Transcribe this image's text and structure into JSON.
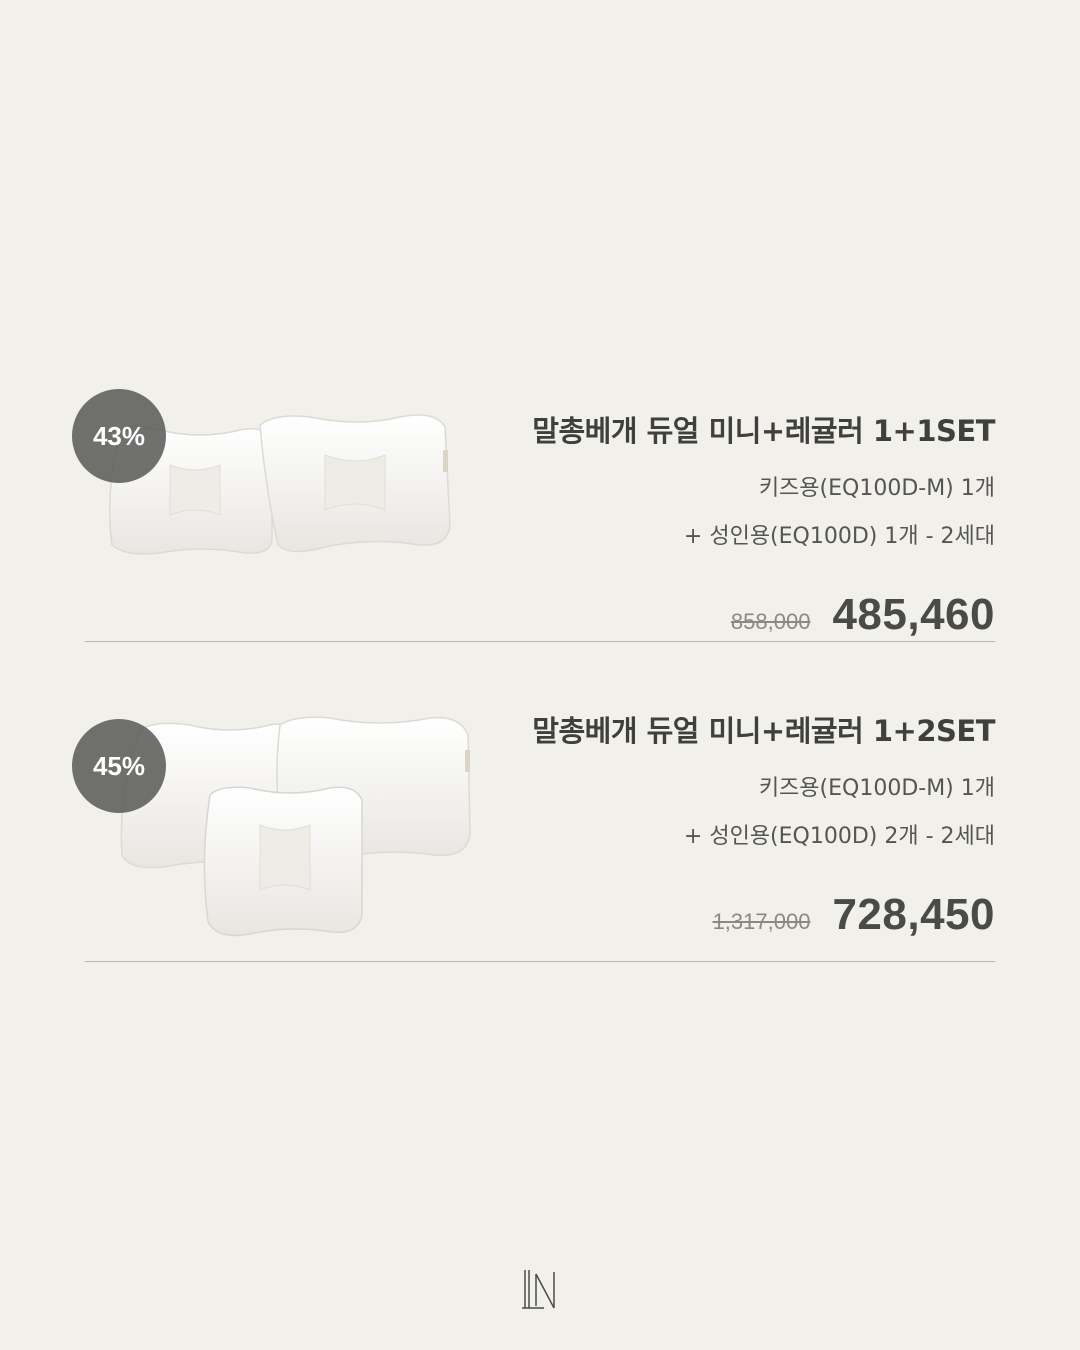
{
  "products": [
    {
      "discount": "43%",
      "title": "말총베개 듀얼 미니+레귤러 1+1SET",
      "line1": "키즈용(EQ100D-M) 1개",
      "line2": "+ 성인용(EQ100D) 1개  - 2세대",
      "original_price": "858,000",
      "sale_price": "485,460"
    },
    {
      "discount": "45%",
      "title": "말총베개 듀얼 미니+레귤러 1+2SET",
      "line1": "키즈용(EQ100D-M) 1개",
      "line2": "+ 성인용(EQ100D) 2개  - 2세대",
      "original_price": "1,317,000",
      "sale_price": "728,450"
    }
  ],
  "colors": {
    "background": "#f2f0eb",
    "badge": "#5c5c5a",
    "text": "#4a4a48"
  },
  "icons": [
    "pillow-image",
    "brand-logo-icon"
  ]
}
